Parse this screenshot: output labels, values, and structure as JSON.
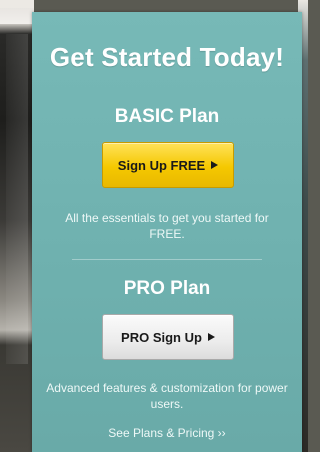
{
  "panel": {
    "title": "Get Started Today!",
    "basic": {
      "plan_title": "BASIC Plan",
      "button_label": "Sign Up FREE",
      "description": "All the essentials to get you started for FREE."
    },
    "pro": {
      "plan_title": "PRO Plan",
      "button_label": "PRO Sign Up",
      "description": "Advanced features & customization for power users."
    },
    "see_plans_link": "See Plans & Pricing ››"
  },
  "colors": {
    "panel_teal": "#72b4b2",
    "free_button": "#f5c800",
    "pro_button": "#ececec"
  },
  "icons": {
    "button_arrow": "triangle-right-icon"
  }
}
